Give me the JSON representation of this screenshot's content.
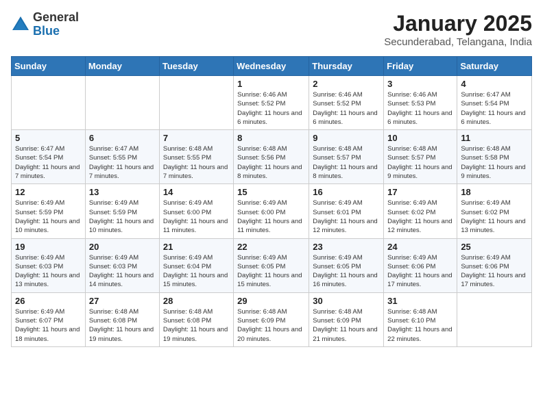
{
  "header": {
    "logo_general": "General",
    "logo_blue": "Blue",
    "title": "January 2025",
    "subtitle": "Secunderabad, Telangana, India"
  },
  "weekdays": [
    "Sunday",
    "Monday",
    "Tuesday",
    "Wednesday",
    "Thursday",
    "Friday",
    "Saturday"
  ],
  "weeks": [
    [
      {
        "day": "",
        "info": ""
      },
      {
        "day": "",
        "info": ""
      },
      {
        "day": "",
        "info": ""
      },
      {
        "day": "1",
        "info": "Sunrise: 6:46 AM\nSunset: 5:52 PM\nDaylight: 11 hours and 6 minutes."
      },
      {
        "day": "2",
        "info": "Sunrise: 6:46 AM\nSunset: 5:52 PM\nDaylight: 11 hours and 6 minutes."
      },
      {
        "day": "3",
        "info": "Sunrise: 6:46 AM\nSunset: 5:53 PM\nDaylight: 11 hours and 6 minutes."
      },
      {
        "day": "4",
        "info": "Sunrise: 6:47 AM\nSunset: 5:54 PM\nDaylight: 11 hours and 6 minutes."
      }
    ],
    [
      {
        "day": "5",
        "info": "Sunrise: 6:47 AM\nSunset: 5:54 PM\nDaylight: 11 hours and 7 minutes."
      },
      {
        "day": "6",
        "info": "Sunrise: 6:47 AM\nSunset: 5:55 PM\nDaylight: 11 hours and 7 minutes."
      },
      {
        "day": "7",
        "info": "Sunrise: 6:48 AM\nSunset: 5:55 PM\nDaylight: 11 hours and 7 minutes."
      },
      {
        "day": "8",
        "info": "Sunrise: 6:48 AM\nSunset: 5:56 PM\nDaylight: 11 hours and 8 minutes."
      },
      {
        "day": "9",
        "info": "Sunrise: 6:48 AM\nSunset: 5:57 PM\nDaylight: 11 hours and 8 minutes."
      },
      {
        "day": "10",
        "info": "Sunrise: 6:48 AM\nSunset: 5:57 PM\nDaylight: 11 hours and 9 minutes."
      },
      {
        "day": "11",
        "info": "Sunrise: 6:48 AM\nSunset: 5:58 PM\nDaylight: 11 hours and 9 minutes."
      }
    ],
    [
      {
        "day": "12",
        "info": "Sunrise: 6:49 AM\nSunset: 5:59 PM\nDaylight: 11 hours and 10 minutes."
      },
      {
        "day": "13",
        "info": "Sunrise: 6:49 AM\nSunset: 5:59 PM\nDaylight: 11 hours and 10 minutes."
      },
      {
        "day": "14",
        "info": "Sunrise: 6:49 AM\nSunset: 6:00 PM\nDaylight: 11 hours and 11 minutes."
      },
      {
        "day": "15",
        "info": "Sunrise: 6:49 AM\nSunset: 6:00 PM\nDaylight: 11 hours and 11 minutes."
      },
      {
        "day": "16",
        "info": "Sunrise: 6:49 AM\nSunset: 6:01 PM\nDaylight: 11 hours and 12 minutes."
      },
      {
        "day": "17",
        "info": "Sunrise: 6:49 AM\nSunset: 6:02 PM\nDaylight: 11 hours and 12 minutes."
      },
      {
        "day": "18",
        "info": "Sunrise: 6:49 AM\nSunset: 6:02 PM\nDaylight: 11 hours and 13 minutes."
      }
    ],
    [
      {
        "day": "19",
        "info": "Sunrise: 6:49 AM\nSunset: 6:03 PM\nDaylight: 11 hours and 13 minutes."
      },
      {
        "day": "20",
        "info": "Sunrise: 6:49 AM\nSunset: 6:03 PM\nDaylight: 11 hours and 14 minutes."
      },
      {
        "day": "21",
        "info": "Sunrise: 6:49 AM\nSunset: 6:04 PM\nDaylight: 11 hours and 15 minutes."
      },
      {
        "day": "22",
        "info": "Sunrise: 6:49 AM\nSunset: 6:05 PM\nDaylight: 11 hours and 15 minutes."
      },
      {
        "day": "23",
        "info": "Sunrise: 6:49 AM\nSunset: 6:05 PM\nDaylight: 11 hours and 16 minutes."
      },
      {
        "day": "24",
        "info": "Sunrise: 6:49 AM\nSunset: 6:06 PM\nDaylight: 11 hours and 17 minutes."
      },
      {
        "day": "25",
        "info": "Sunrise: 6:49 AM\nSunset: 6:06 PM\nDaylight: 11 hours and 17 minutes."
      }
    ],
    [
      {
        "day": "26",
        "info": "Sunrise: 6:49 AM\nSunset: 6:07 PM\nDaylight: 11 hours and 18 minutes."
      },
      {
        "day": "27",
        "info": "Sunrise: 6:48 AM\nSunset: 6:08 PM\nDaylight: 11 hours and 19 minutes."
      },
      {
        "day": "28",
        "info": "Sunrise: 6:48 AM\nSunset: 6:08 PM\nDaylight: 11 hours and 19 minutes."
      },
      {
        "day": "29",
        "info": "Sunrise: 6:48 AM\nSunset: 6:09 PM\nDaylight: 11 hours and 20 minutes."
      },
      {
        "day": "30",
        "info": "Sunrise: 6:48 AM\nSunset: 6:09 PM\nDaylight: 11 hours and 21 minutes."
      },
      {
        "day": "31",
        "info": "Sunrise: 6:48 AM\nSunset: 6:10 PM\nDaylight: 11 hours and 22 minutes."
      },
      {
        "day": "",
        "info": ""
      }
    ]
  ]
}
